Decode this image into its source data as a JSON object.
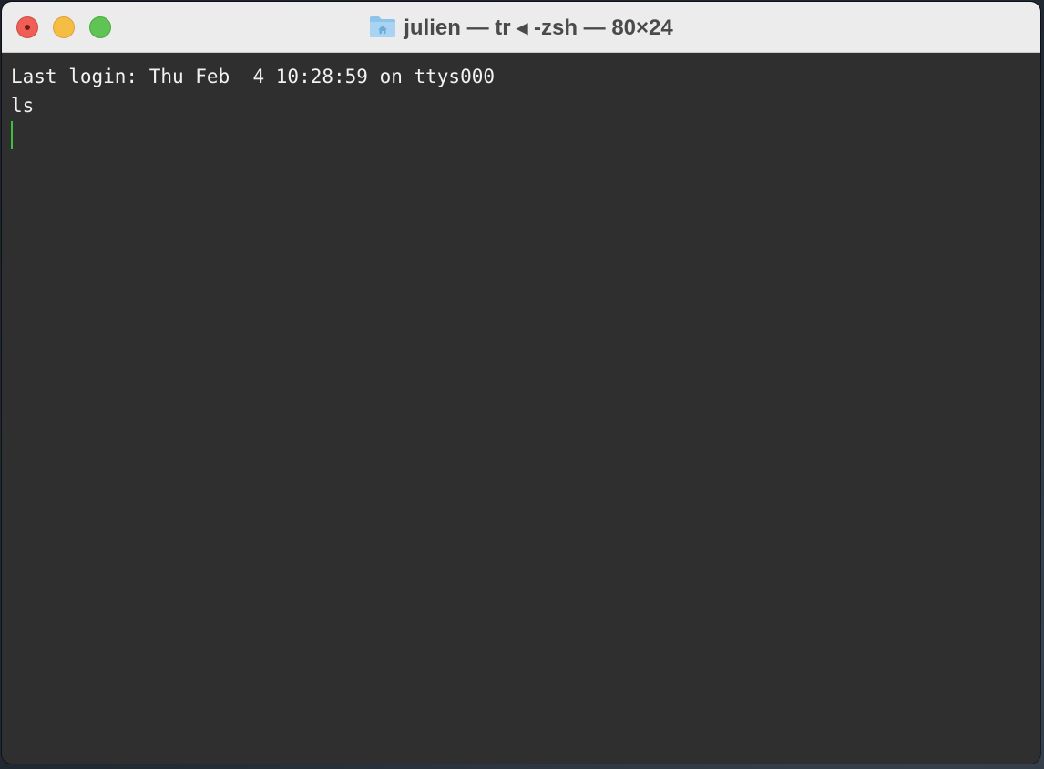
{
  "window": {
    "title": "julien — tr ◂ -zsh — 80×24",
    "folder_icon": "home-folder-icon"
  },
  "traffic_lights": {
    "close_color": "#ee5f57",
    "minimize_color": "#f6bd44",
    "zoom_color": "#5fc454"
  },
  "terminal": {
    "background": "#2f2f2f",
    "text_color": "#f2f2f2",
    "cursor_color": "#3fbf3f",
    "lines": [
      "Last login: Thu Feb  4 10:28:59 on ttys000",
      "ls"
    ]
  }
}
